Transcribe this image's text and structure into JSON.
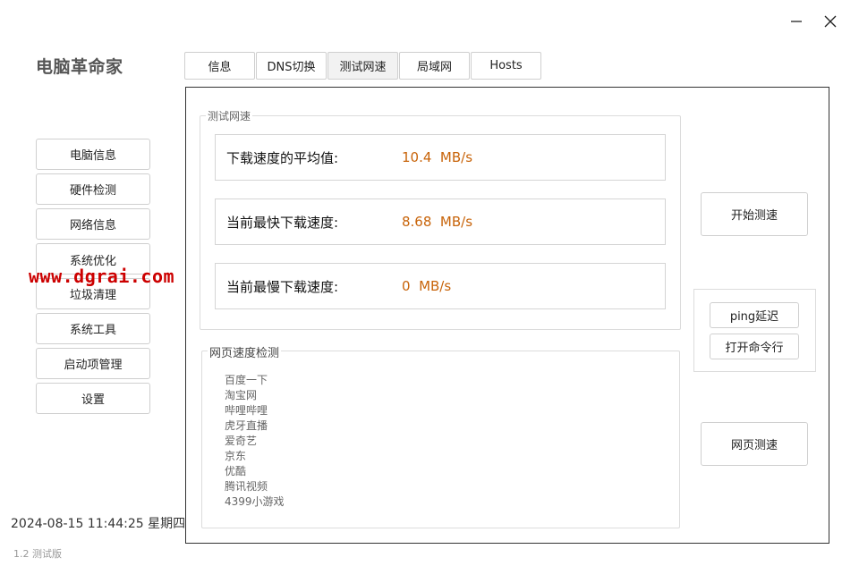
{
  "window": {
    "minimize_icon": "minimize-icon",
    "close_icon": "close-icon"
  },
  "app": {
    "title": "电脑革命家",
    "datetime": "2024-08-15 11:44:25  星期四",
    "version": "1.2  测试版",
    "watermark": "www.dgrai.com"
  },
  "sidebar": {
    "items": [
      {
        "label": "电脑信息"
      },
      {
        "label": "硬件检测"
      },
      {
        "label": "网络信息"
      },
      {
        "label": "系统优化"
      },
      {
        "label": "垃圾清理"
      },
      {
        "label": "系统工具"
      },
      {
        "label": "启动项管理"
      },
      {
        "label": "设置"
      }
    ]
  },
  "tabs": [
    {
      "label": "信息"
    },
    {
      "label": "DNS切换"
    },
    {
      "label": "测试网速"
    },
    {
      "label": "局域网"
    },
    {
      "label": "Hosts"
    }
  ],
  "speed_test": {
    "group_title": "测试网速",
    "stats": [
      {
        "label": "下载速度的平均值:",
        "value": "10.4  MB/s"
      },
      {
        "label": "当前最快下载速度:",
        "value": "8.68  MB/s"
      },
      {
        "label": "当前最慢下载速度:",
        "value": "0  MB/s"
      }
    ],
    "start_button": "开始测速"
  },
  "web_speed": {
    "group_title": "网页速度检测",
    "sites": [
      "百度一下",
      "淘宝网",
      "哔哩哔哩",
      "虎牙直播",
      "爱奇艺",
      "京东",
      "优酷",
      "腾讯视频",
      "4399小游戏"
    ],
    "test_button": "网页测速"
  },
  "tools": {
    "ping_button": "ping延迟",
    "cmd_button": "打开命令行"
  }
}
